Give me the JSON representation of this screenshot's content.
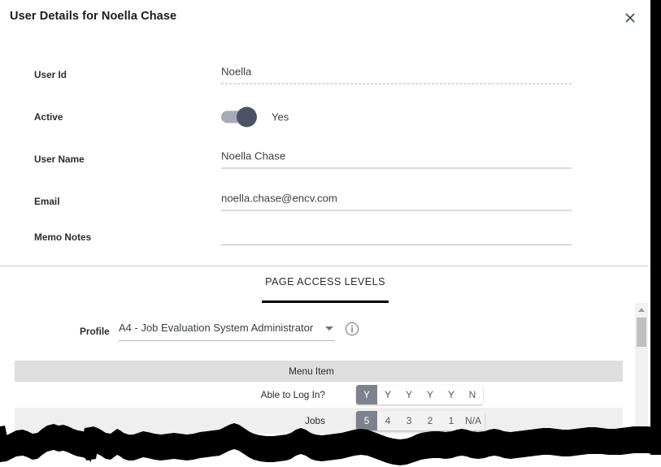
{
  "dialog": {
    "title": "User Details for Noella Chase",
    "close_label": "close-icon"
  },
  "form": {
    "fields": [
      {
        "label": "User Id",
        "value": "Noella",
        "underline": "dashed",
        "type": "text"
      },
      {
        "label": "Active",
        "value": "Yes",
        "underline": "none",
        "type": "toggle",
        "toggle_on": true
      },
      {
        "label": "User Name",
        "value": "Noella Chase",
        "underline": "solid",
        "type": "text"
      },
      {
        "label": "Email",
        "value": "noella.chase@encv.com",
        "underline": "solid",
        "type": "text"
      },
      {
        "label": "Memo Notes",
        "value": "",
        "underline": "solid",
        "type": "text"
      }
    ]
  },
  "tabs": {
    "items": [
      {
        "label": "PAGE ACCESS LEVELS",
        "active": true
      }
    ]
  },
  "profile": {
    "label": "Profile",
    "selected": "A4 - Job Evaluation System Administrator",
    "caret": "chevron-down-icon",
    "info": "info-icon"
  },
  "table": {
    "header": "Menu Item",
    "rows": [
      {
        "label": "Able to Log In?",
        "options": [
          "Y",
          "Y",
          "Y",
          "Y",
          "Y",
          "N"
        ],
        "selected_index": 0
      },
      {
        "label": "Jobs",
        "options": [
          "5",
          "4",
          "3",
          "2",
          "1",
          "N/A"
        ],
        "selected_index": 0
      }
    ]
  },
  "scrollbar": {
    "up_arrow": "scroll-up-arrow-icon"
  },
  "colors": {
    "accent": "#000000",
    "toggle_knob": "#4d5365",
    "toggle_track": "#a7abb6",
    "segment_selected": "#7d838c",
    "table_header": "#dedede",
    "row_alt": "#efefef"
  }
}
